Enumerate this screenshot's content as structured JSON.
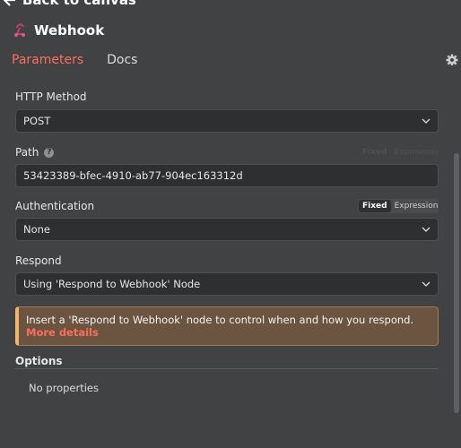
{
  "nav": {
    "back_label": "Back to canvas"
  },
  "node": {
    "title": "Webhook",
    "icon": "webhook-icon"
  },
  "tabs": [
    {
      "label": "Parameters",
      "active": true
    },
    {
      "label": "Docs",
      "active": false
    }
  ],
  "colors": {
    "accent": "#ff6d5a",
    "panel": "#414244",
    "field": "#2e2f31",
    "notice_bg": "#6b5541",
    "notice_border": "#f3b26d"
  },
  "params": {
    "http_method": {
      "label": "HTTP Method",
      "value": "POST"
    },
    "path": {
      "label": "Path",
      "value": "53423389-bfec-4910-ab77-904ec163312d",
      "toggle": {
        "fixed": "Fixed",
        "expression": "Expression"
      }
    },
    "authentication": {
      "label": "Authentication",
      "value": "None",
      "toggle": {
        "fixed": "Fixed",
        "expression": "Expression"
      }
    },
    "respond": {
      "label": "Respond",
      "value": "Using 'Respond to Webhook' Node"
    }
  },
  "notice": {
    "text": "Insert a 'Respond to Webhook' node to control when and how you respond.",
    "link": "More details"
  },
  "options": {
    "label": "Options",
    "empty_text": "No properties"
  }
}
